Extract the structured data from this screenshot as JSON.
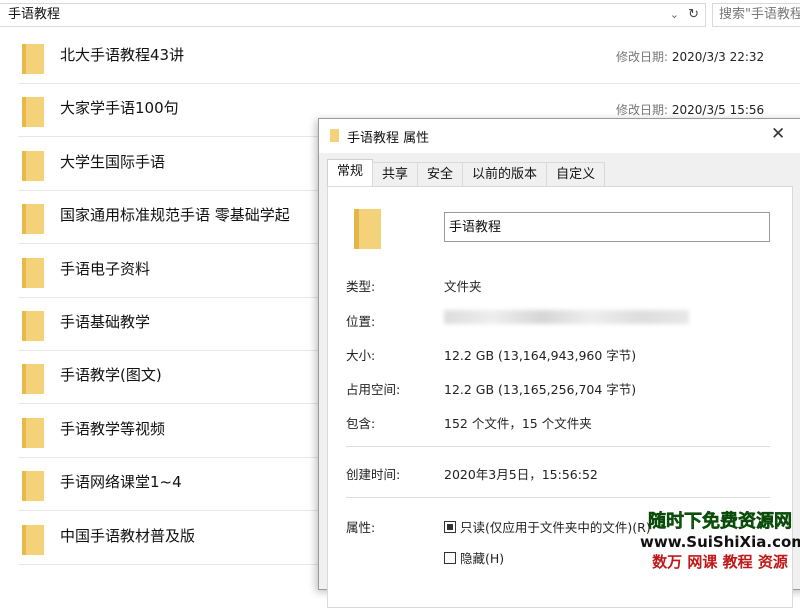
{
  "address": {
    "path": "手语教程",
    "search_placeholder": "搜索\"手语教程\""
  },
  "date_label": "修改日期:",
  "folders": [
    {
      "name": "北大手语教程43讲",
      "modified": "2020/3/3 22:32"
    },
    {
      "name": "大家学手语100句",
      "modified": "2020/3/5 15:56"
    },
    {
      "name": "大学生国际手语"
    },
    {
      "name": "国家通用标准规范手语 零基础学起"
    },
    {
      "name": "手语电子资料"
    },
    {
      "name": "手语基础教学"
    },
    {
      "name": "手语教学(图文)"
    },
    {
      "name": "手语教学等视频"
    },
    {
      "name": "手语网络课堂1~4"
    },
    {
      "name": "中国手语教材普及版"
    }
  ],
  "dialog": {
    "title": "手语教程 属性",
    "tabs": [
      "常规",
      "共享",
      "安全",
      "以前的版本",
      "自定义"
    ],
    "name_value": "手语教程",
    "fields": [
      {
        "label": "类型:",
        "value": "文件夹"
      },
      {
        "label": "位置:",
        "value": ""
      },
      {
        "label": "大小:",
        "value": "12.2 GB (13,164,943,960 字节)"
      },
      {
        "label": "占用空间:",
        "value": "12.2 GB (13,165,256,704 字节)"
      },
      {
        "label": "包含:",
        "value": "152 个文件，15 个文件夹"
      }
    ],
    "created_label": "创建时间:",
    "created_value": "2020年3月5日，15:56:52",
    "attributes_label": "属性:",
    "readonly_label": "只读(仅应用于文件夹中的文件)(R)",
    "hidden_label": "隐藏(H)"
  },
  "watermark": {
    "line1": "随时下免费资源网",
    "line2": "www.SuiShiXia.com",
    "line3": "数万 网课 教程 资源"
  }
}
